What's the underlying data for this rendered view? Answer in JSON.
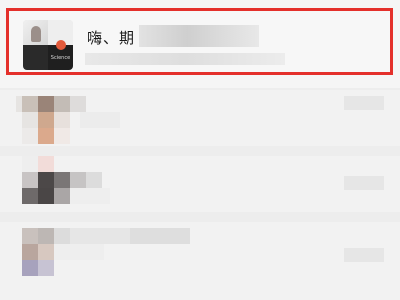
{
  "chat_list": {
    "highlighted_chat": {
      "title": "嗨、期",
      "avatar_tile_text": "Science"
    }
  },
  "colors": {
    "highlight_border": "#e4302b",
    "background": "#ededed"
  }
}
